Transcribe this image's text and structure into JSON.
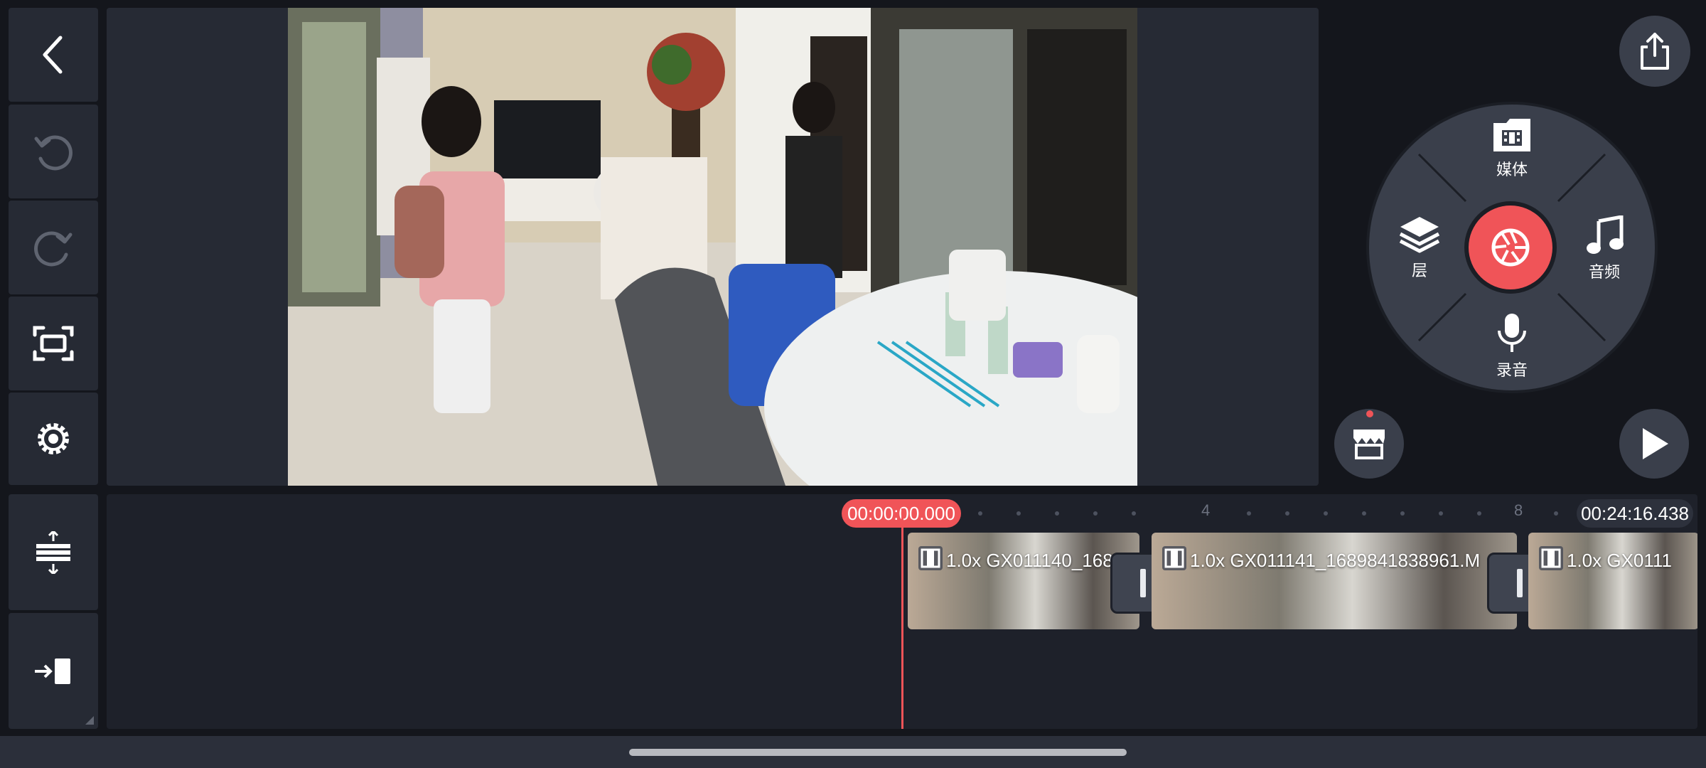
{
  "toolbar": {
    "back_icon": "chevron-left-icon",
    "undo_icon": "undo-icon",
    "redo_icon": "redo-icon",
    "fullscreen_icon": "fullscreen-capture-icon",
    "settings_icon": "gear-icon"
  },
  "timeline_tools": {
    "expand_icon": "expand-vertical-icon",
    "jump_icon": "jump-to-end-icon"
  },
  "media_wheel": {
    "top_label": "媒体",
    "left_label": "层",
    "right_label": "音频",
    "bottom_label": "录音",
    "center_icon": "camera-shutter-icon"
  },
  "right_buttons": {
    "share_icon": "share-icon",
    "store_icon": "store-icon",
    "play_icon": "play-icon"
  },
  "timeline": {
    "current_time": "00:00:00.000",
    "total_time": "00:24:16.438",
    "ruler_labels": [
      "4",
      "8"
    ],
    "clips": [
      {
        "label": "1.0x GX011140_168"
      },
      {
        "label": "1.0x GX011141_1689841838961.M"
      },
      {
        "label": "1.0x GX0111"
      }
    ]
  },
  "colors": {
    "accent": "#f05458",
    "panel": "#262a34",
    "background": "#14161c"
  }
}
